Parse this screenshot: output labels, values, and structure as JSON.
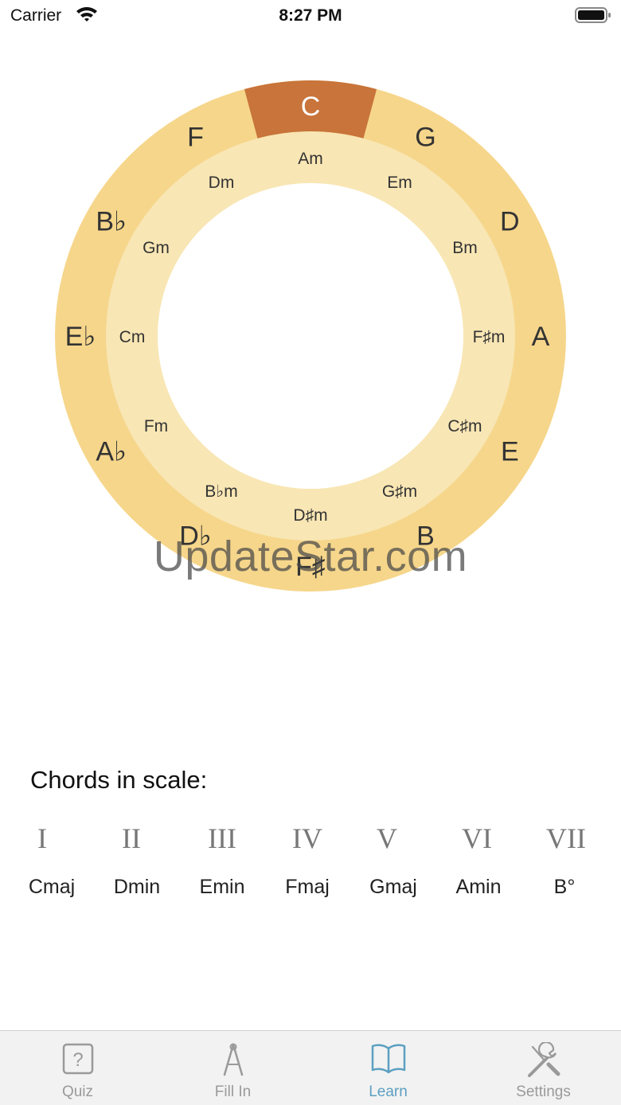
{
  "status_bar": {
    "carrier": "Carrier",
    "time": "8:27 PM"
  },
  "circle": {
    "selected_major": "C",
    "major_keys": [
      "C",
      "G",
      "D",
      "A",
      "E",
      "B",
      "F♯",
      "D♭",
      "A♭",
      "E♭",
      "B♭",
      "F"
    ],
    "minor_keys": [
      "Am",
      "Em",
      "Bm",
      "F♯m",
      "C♯m",
      "G♯m",
      "D♯m",
      "B♭m",
      "Fm",
      "Cm",
      "Gm",
      "Dm"
    ],
    "colors": {
      "outer_ring": "#f6d68b",
      "inner_ring": "#f8e6b4",
      "selected": "#c8743a"
    }
  },
  "watermark": "UpdateStar.com",
  "chords": {
    "title": "Chords in scale:",
    "numerals": [
      "I",
      "II",
      "III",
      "IV",
      "V",
      "VI",
      "VII"
    ],
    "names": [
      "Cmaj",
      "Dmin",
      "Emin",
      "Fmaj",
      "Gmaj",
      "Amin",
      "B°"
    ]
  },
  "tabs": [
    {
      "label": "Quiz",
      "icon": "question-box-icon",
      "active": false
    },
    {
      "label": "Fill In",
      "icon": "compass-icon",
      "active": false
    },
    {
      "label": "Learn",
      "icon": "book-icon",
      "active": true
    },
    {
      "label": "Settings",
      "icon": "wrench-screwdriver-icon",
      "active": false
    }
  ]
}
